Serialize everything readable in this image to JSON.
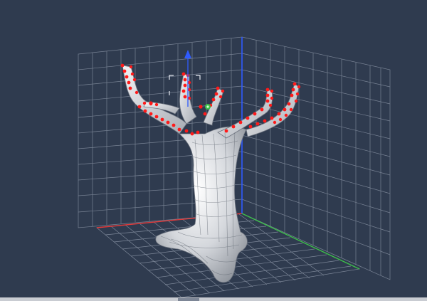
{
  "viewport": {
    "background": "#2f3b4f",
    "grid_color": "#8a94a5",
    "axis_colors": {
      "x": "#e23a3a",
      "y": "#2f5bff",
      "z": "#3dbf4a"
    },
    "model": {
      "name_icon": "tree-mesh-icon",
      "mesh_color": "#d8dbe0",
      "selected_vertex_color": "#ff1a1a"
    },
    "gizmo": {
      "icon": "move-gizmo-icon",
      "up_arrow_color": "#2f5bff",
      "pivot_color": "#3dbf4a"
    }
  }
}
